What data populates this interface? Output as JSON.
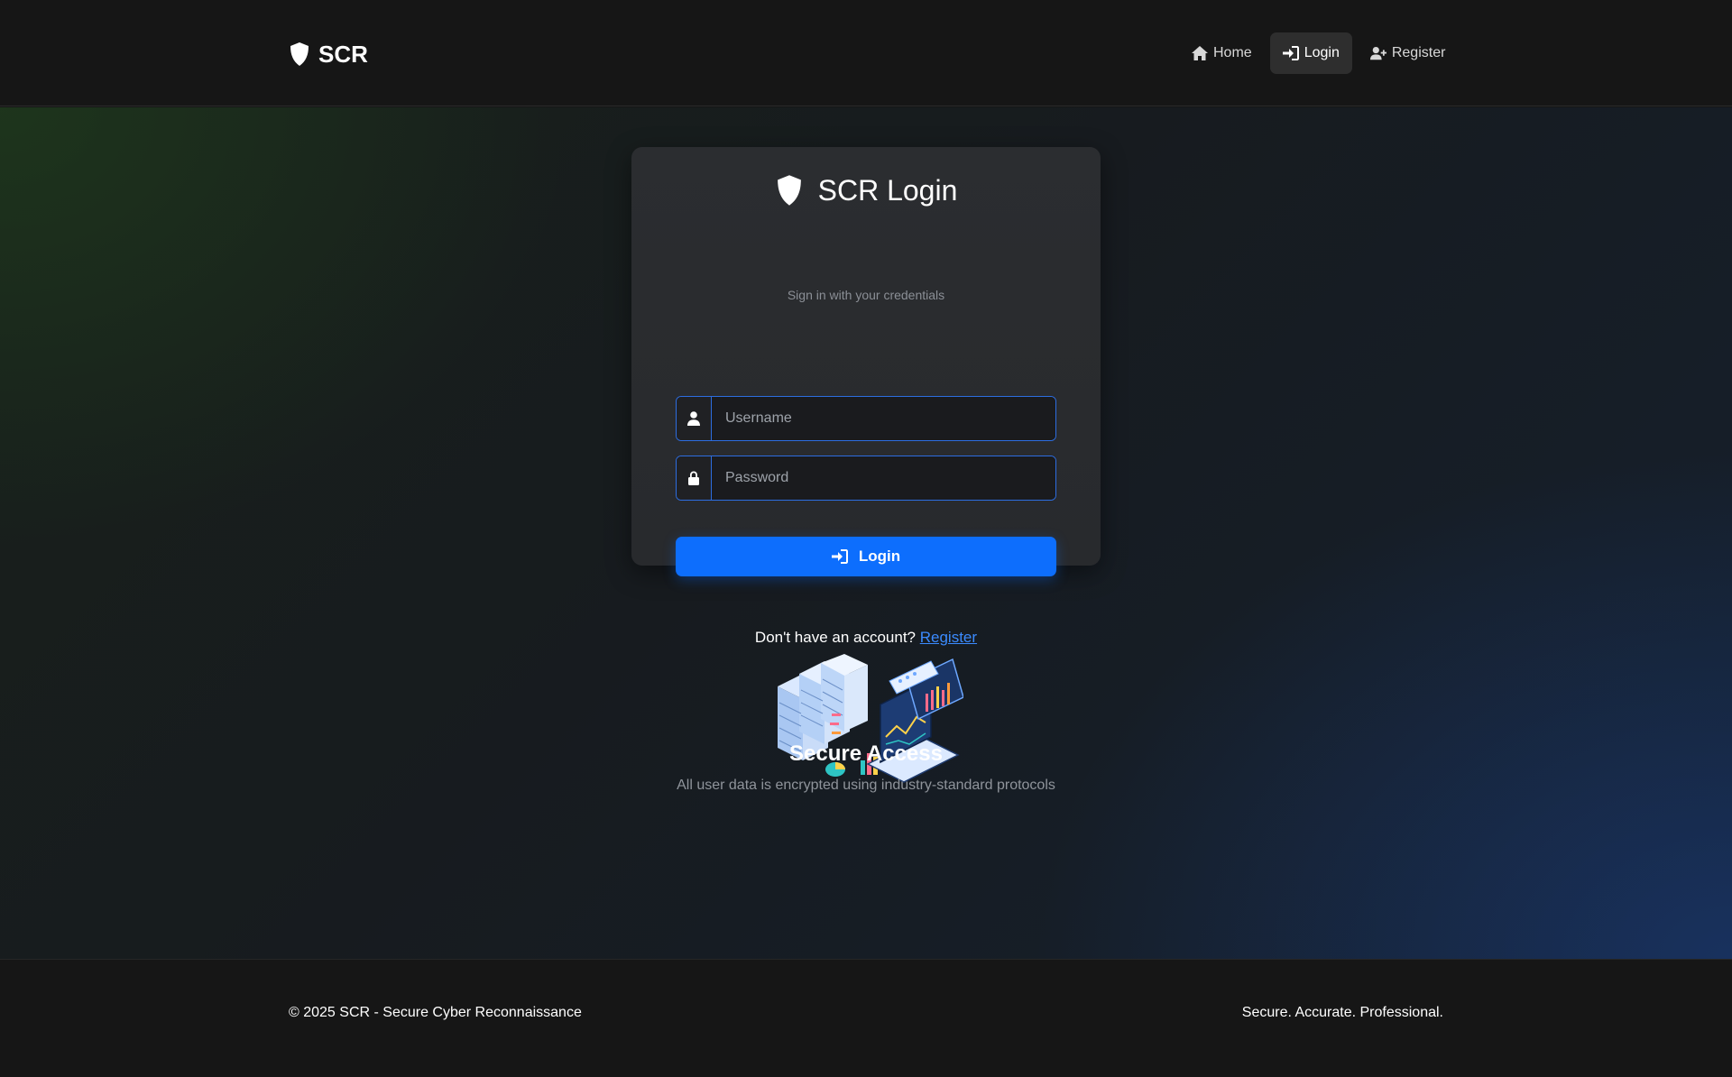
{
  "navbar": {
    "brand": "SCR",
    "items": [
      {
        "label": "Home",
        "icon": "home-icon",
        "active": false
      },
      {
        "label": "Login",
        "icon": "login-icon",
        "active": true
      },
      {
        "label": "Register",
        "icon": "user-plus-icon",
        "active": false
      }
    ]
  },
  "card": {
    "title": "SCR Login",
    "subtitle": "Sign in with your credentials",
    "username_placeholder": "Username",
    "password_placeholder": "Password",
    "login_button": "Login",
    "signup_prompt": "Don't have an account?",
    "signup_link": "Register"
  },
  "info": {
    "title": "Secure Access",
    "subtitle": "All user data is encrypted using industry-standard protocols"
  },
  "footer": {
    "left": "© 2025 SCR - Secure Cyber Reconnaissance",
    "right": "Secure. Accurate. Professional."
  },
  "colors": {
    "accent": "#0d6efd",
    "link": "#3b8bff",
    "input_border": "#2d6de0"
  }
}
